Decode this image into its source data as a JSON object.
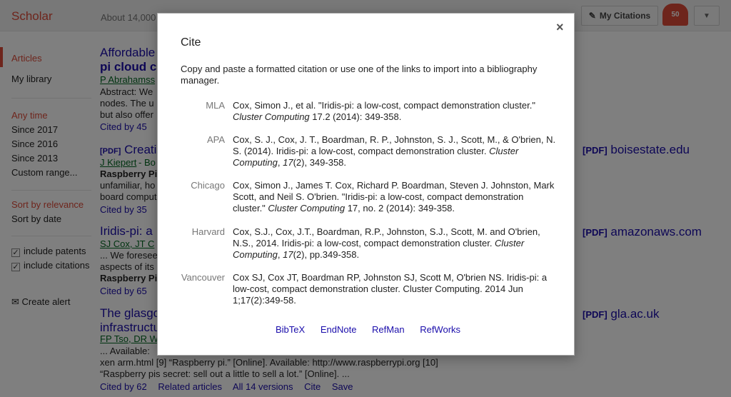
{
  "header": {
    "logo": "Scholar",
    "about": "About 14,000",
    "my_citations": "My Citations",
    "bell_count": "50"
  },
  "sidebar": {
    "items": [
      "Articles",
      "My library"
    ],
    "time_label": "Any time",
    "time_items": [
      "Since 2017",
      "Since 2016",
      "Since 2013",
      "Custom range..."
    ],
    "sort_relevance": "Sort by relevance",
    "sort_date": "Sort by date",
    "include_patents": "include patents",
    "include_citations": "include citations",
    "create_alert": "Create alert"
  },
  "results": [
    {
      "title_a": "Affordable",
      "title_b": "pi cloud cl",
      "author": "P Abrahamss",
      "snip": [
        "Abstract: We",
        "nodes. The u",
        "but also offer"
      ],
      "cited": "Cited by 45"
    },
    {
      "tag": "[PDF]",
      "title": "Creati",
      "author": "J Kiepert",
      "author2": "- Bo",
      "snip": [
        "Raspberry Pi",
        "unfamiliar, ho",
        "board comput"
      ],
      "cited": "Cited by 35",
      "pdf_tag": "[PDF]",
      "pdf_src": "boisestate.edu"
    },
    {
      "title": "Iridis-pi: a",
      "author": "SJ Cox, JT C",
      "snip": [
        "... We foresee",
        "aspects of its",
        "Raspberry Pi"
      ],
      "cited": "Cited by 65",
      "pdf_tag": "[PDF]",
      "pdf_src": "amazonaws.com"
    },
    {
      "title_a": "The glasgo",
      "title_b": "infrastructu",
      "author": "FP Tso, DR W",
      "snip_a": "... Available:",
      "snip_b": "xen arm.html [9] “Raspberry pi.” [Online]. Available: http://www.raspberrypi.org [10]",
      "snip_c": "“Raspberry pis secret: sell out a little to sell a lot.” [Online]. ...",
      "links": [
        "Cited by 62",
        "Related articles",
        "All 14 versions",
        "Cite",
        "Save"
      ],
      "pdf_tag": "[PDF]",
      "pdf_src": "gla.ac.uk"
    }
  ],
  "modal": {
    "title": "Cite",
    "close": "×",
    "intro": "Copy and paste a formatted citation or use one of the links to import into a bibliography manager.",
    "citations": [
      {
        "style": "MLA",
        "text_a": "Cox, Simon J., et al. \"Iridis-pi: a low-cost, compact demonstration cluster.\" ",
        "journal": "Cluster Computing",
        "text_b": " 17.2 (2014): 349-358."
      },
      {
        "style": "APA",
        "text_a": "Cox, S. J., Cox, J. T., Boardman, R. P., Johnston, S. J., Scott, M., & O'brien, N. S. (2014). Iridis-pi: a low-cost, compact demonstration cluster. ",
        "journal": "Cluster Computing",
        "text_b": ", ",
        "vol": "17",
        "text_c": "(2), 349-358."
      },
      {
        "style": "Chicago",
        "text_a": "Cox, Simon J., James T. Cox, Richard P. Boardman, Steven J. Johnston, Mark Scott, and Neil S. O'brien. \"Iridis-pi: a low-cost, compact demonstration cluster.\" ",
        "journal": "Cluster Computing",
        "text_b": " 17, no. 2 (2014): 349-358."
      },
      {
        "style": "Harvard",
        "text_a": "Cox, S.J., Cox, J.T., Boardman, R.P., Johnston, S.J., Scott, M. and O'brien, N.S., 2014. Iridis-pi: a low-cost, compact demonstration cluster. ",
        "journal": "Cluster Computing",
        "text_b": ", ",
        "vol": "17",
        "text_c": "(2), pp.349-358."
      },
      {
        "style": "Vancouver",
        "text_a": "Cox SJ, Cox JT, Boardman RP, Johnston SJ, Scott M, O'brien NS. Iridis-pi: a low-cost, compact demonstration cluster. Cluster Computing. 2014 Jun 1;17(2):349-58."
      }
    ],
    "exports": [
      "BibTeX",
      "EndNote",
      "RefMan",
      "RefWorks"
    ]
  }
}
